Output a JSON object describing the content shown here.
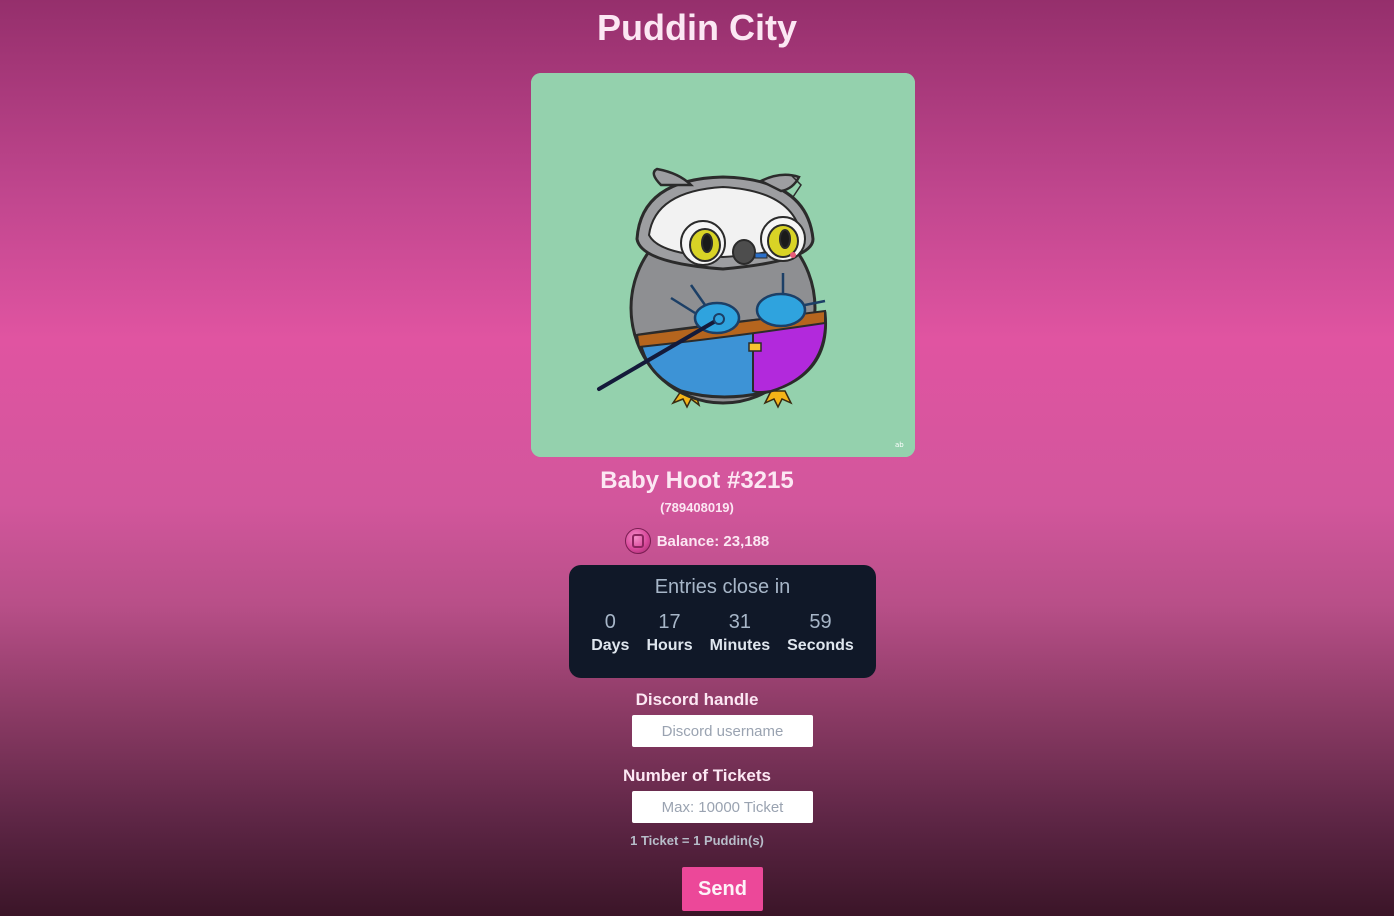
{
  "header": {
    "title": "Puddin City"
  },
  "nft": {
    "name": "Baby Hoot #3215",
    "id": "(789408019)",
    "image_alt": "Baby Hoot owl wearing a helmet, blue goggles and holding a pointer",
    "background_color": "#94d1ad"
  },
  "wallet": {
    "balance_label": "Balance: 23,188",
    "coin_icon": "puddin-coin-icon"
  },
  "countdown": {
    "title": "Entries close in",
    "units": [
      {
        "value": "0",
        "label": "Days"
      },
      {
        "value": "17",
        "label": "Hours"
      },
      {
        "value": "31",
        "label": "Minutes"
      },
      {
        "value": "59",
        "label": "Seconds"
      }
    ]
  },
  "form": {
    "discord_label": "Discord handle",
    "discord_placeholder": "Discord username",
    "discord_value": "",
    "tickets_label": "Number of Tickets",
    "tickets_placeholder": "Max: 10000 Ticket",
    "tickets_value": "",
    "ticket_note": "1 Ticket = 1 Puddin(s)",
    "send_label": "Send"
  },
  "colors": {
    "accent": "#ec4899",
    "countdown_bg": "#101828",
    "text": "#fce7f3"
  }
}
